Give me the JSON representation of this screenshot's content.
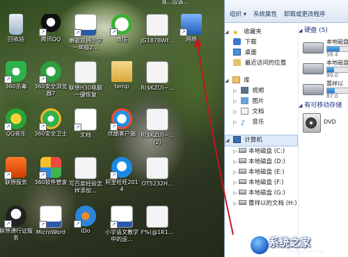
{
  "desktop": {
    "icons": [
      {
        "label": "回收站",
        "kind": "recycle"
      },
      {
        "label": "腾讯QQ",
        "kind": "qq"
      },
      {
        "label": "磨歌双拥小学一年级2...",
        "kind": "word"
      },
      {
        "label": "微信",
        "kind": "wechat"
      },
      {
        "label": "JG187BWF...",
        "kind": "doc"
      },
      {
        "label": "网络",
        "kind": "network"
      },
      {
        "label": "360杀毒",
        "kind": "shield"
      },
      {
        "label": "360安全浏览器7",
        "kind": "browser"
      },
      {
        "label": "联想H30电脑一键恢复",
        "kind": "doc"
      },
      {
        "label": "temp",
        "kind": "folder"
      },
      {
        "label": "R($KZU)~...",
        "kind": "doc"
      },
      {
        "label": "QQ音乐",
        "kind": "qqmusic"
      },
      {
        "label": "360安全卫士",
        "kind": "guard"
      },
      {
        "label": "文档",
        "kind": "txt"
      },
      {
        "label": "优酷客户端",
        "kind": "youku"
      },
      {
        "label": "R($KZU)~... (2)",
        "kind": "doc"
      },
      {
        "label": "联想服务",
        "kind": "lenovo"
      },
      {
        "label": "360软件管家",
        "kind": "softmgr"
      },
      {
        "label": "写百度经验怎样添加...",
        "kind": "doc"
      },
      {
        "label": "阿里旺旺2014",
        "kind": "wangwang"
      },
      {
        "label": "OT5232H...",
        "kind": "doc"
      },
      {
        "label": "联想通行证服务",
        "kind": "lenovoid"
      },
      {
        "label": "MicroWord",
        "kind": "word"
      },
      {
        "label": "iDo",
        "kind": "ido"
      },
      {
        "label": "小学语文教学中的运...",
        "kind": "word"
      },
      {
        "label": "F%(@1R1...",
        "kind": "doc"
      }
    ],
    "top_partial_text": "准...应该..."
  },
  "explorer": {
    "toolbar": [
      "组织 ▾",
      "系统属性",
      "卸载或更改程序"
    ],
    "nav": {
      "favorites_label": "收藏夹",
      "favorites": [
        "下载",
        "桌面",
        "最近访问的位置"
      ],
      "library_label": "库",
      "library": [
        "视频",
        "图片",
        "文档",
        "音乐"
      ],
      "computer_label": "计算机",
      "computer": [
        "本地磁盘 (C:)",
        "本地磁盘 (D:)",
        "本地磁盘 (E:)",
        "本地磁盘 (F:)",
        "本地磁盘 (G:)",
        "蕾祥以的文档 (H:)"
      ]
    },
    "hdd_header": "硬盘 (5)",
    "drives": [
      {
        "name": "本地磁盘",
        "free": "58.4",
        "used_fraction": 0.55
      },
      {
        "name": "本地磁盘",
        "free": "99.0",
        "used_fraction": 0.3
      },
      {
        "name": "蕾祥以",
        "free": "87.0",
        "used_fraction": 0.35
      }
    ],
    "removable_header": "有可移动存储",
    "dvd_label": "DVD"
  },
  "watermark": {
    "text": "系统之家",
    "url": "xitongzhijia.net"
  },
  "colors": {
    "toolbar_text": "#1e395b",
    "section_header": "#1e3287",
    "arrow": "#c4161c"
  }
}
